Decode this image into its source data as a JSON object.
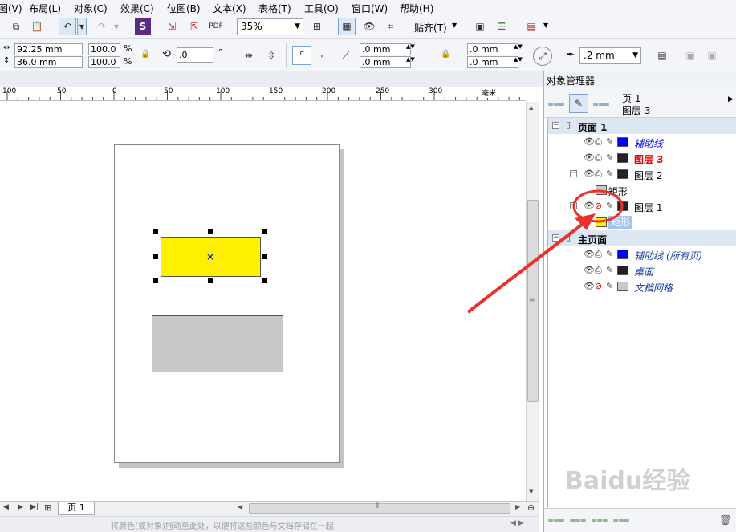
{
  "menu": [
    "图(V)",
    "布局(L)",
    "对象(C)",
    "效果(C)",
    "位图(B)",
    "文本(X)",
    "表格(T)",
    "工具(O)",
    "窗口(W)",
    "帮助(H)"
  ],
  "toolbar": {
    "zoom": "35%",
    "snap_label": "贴齐(T)"
  },
  "property_bar": {
    "width": "92.25 mm",
    "height": "36.0 mm",
    "scale_x": "100.0",
    "scale_y": "100.0",
    "percent": "%",
    "angle": ".0",
    "degree": "°",
    "corner_1": ".0 mm",
    "corner_2": ".0 mm",
    "corner_3": ".0 mm",
    "corner_4": ".0 mm",
    "outline": ".2 mm"
  },
  "ruler": {
    "ticks": [
      "100",
      "50",
      "0",
      "50",
      "100",
      "150",
      "200",
      "250",
      "300"
    ],
    "unit": "毫米"
  },
  "page_tab": "页 1",
  "status_hint": "将颜色(或对象)拖动至此处，以便将这些颜色与文档存储在一起",
  "panel": {
    "title": "对象管理器",
    "current_page": "页 1",
    "current_layer": "图层 3",
    "rows": [
      {
        "kind": "header",
        "label": "页面 1"
      },
      {
        "kind": "layer",
        "label": "辅助线",
        "italic": true,
        "color": "#0000ff",
        "swatch": "#0000ff"
      },
      {
        "kind": "layer",
        "label": "图层 3",
        "bold": true,
        "color": "#e00000",
        "swatch": "#222222"
      },
      {
        "kind": "layer",
        "label": "图层 2",
        "color": "#000000",
        "swatch": "#222222",
        "toggle": "⊟"
      },
      {
        "kind": "object",
        "label": "矩形",
        "swatch": "#c8c8c8"
      },
      {
        "kind": "layer",
        "label": "图层 1",
        "color": "#000000",
        "swatch": "#222222",
        "toggle": "⊟",
        "no_print": true
      },
      {
        "kind": "object",
        "label": "矩形",
        "swatch": "#fff000",
        "selected": true
      },
      {
        "kind": "header",
        "label": "主页面"
      },
      {
        "kind": "layer",
        "label": "辅助线 (所有页)",
        "italic": true,
        "color": "#1a3fa0",
        "swatch": "#0000ff"
      },
      {
        "kind": "layer",
        "label": "桌面",
        "italic": true,
        "color": "#1a3fa0",
        "swatch": "#222222"
      },
      {
        "kind": "layer",
        "label": "文档网格",
        "italic": true,
        "color": "#1a3fa0",
        "swatch": "#c8c8c8",
        "no_print": true
      }
    ]
  },
  "shapes": {
    "selected_fill": "#fff000",
    "other_fill": "#c8c8c8"
  },
  "annotation_color": "#e8322a",
  "watermark": "Baidu经验"
}
